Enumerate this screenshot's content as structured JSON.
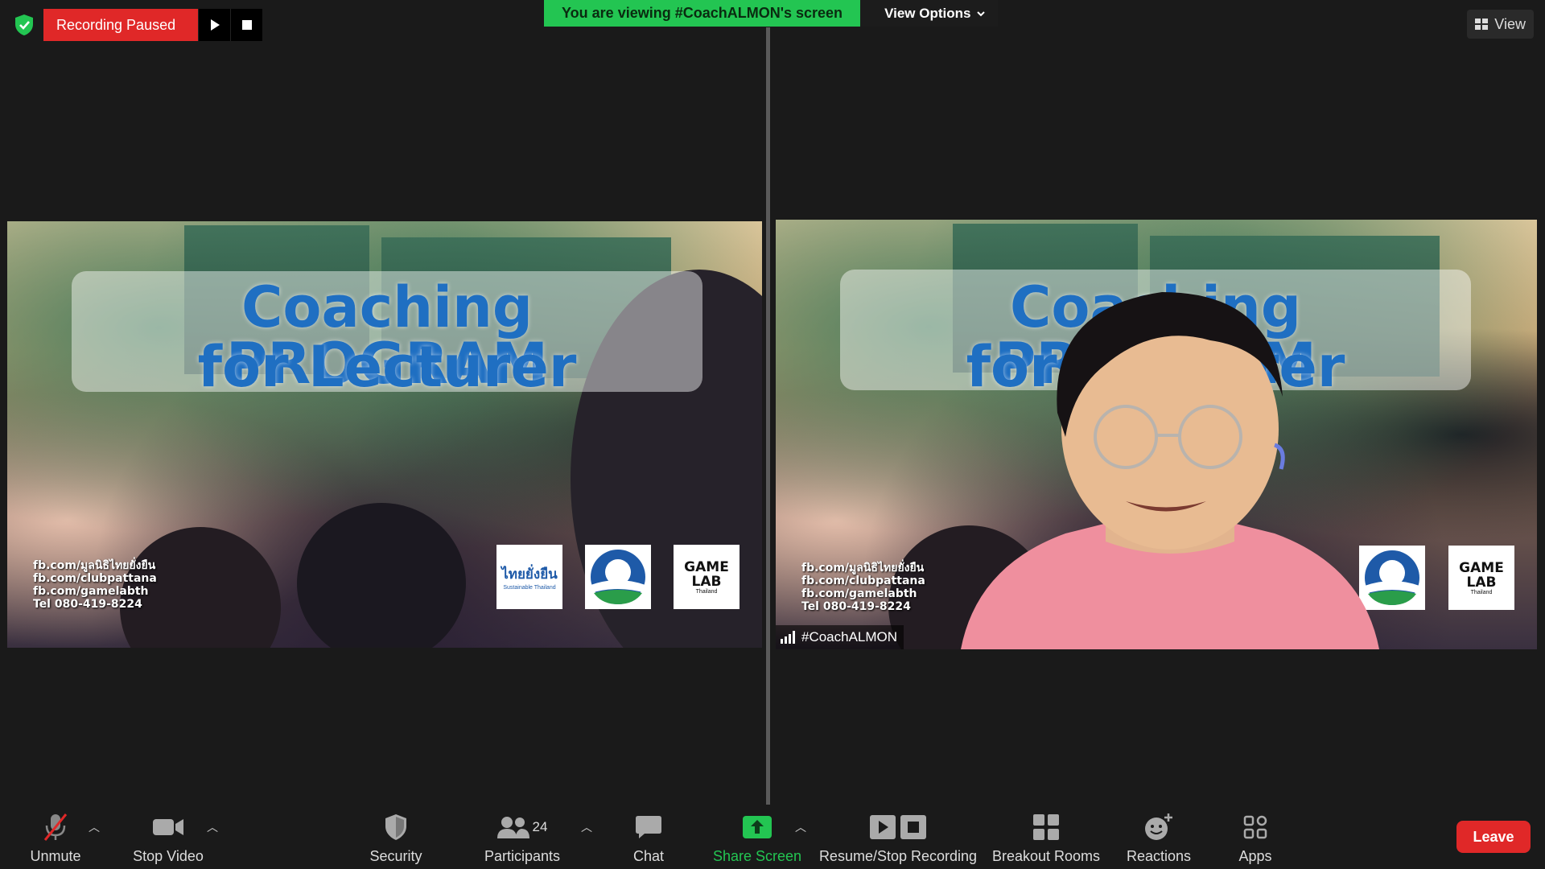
{
  "top_bar": {
    "recording_status": "Recording Paused",
    "viewing_banner": "You are viewing #CoachALMON's screen",
    "view_options_label": "View Options",
    "view_label": "View"
  },
  "shared_screen": {
    "title_line1": "Coaching PROGRAM",
    "title_line2": "for Lecturer",
    "info_lines": [
      "fb.com/มูลนิธิไทยยั่งยืน",
      "fb.com/clubpattana",
      "fb.com/gamelabth",
      "Tel 080-419-8224"
    ],
    "logo1_text": "ไทยยั่งยืน",
    "logo1_sub": "Sustainable Thailand",
    "logo3_line1": "GAME",
    "logo3_line2": "LAB",
    "logo3_sub": "Thailand"
  },
  "speaker": {
    "name": "#CoachALMON"
  },
  "toolbar": {
    "unmute": "Unmute",
    "stop_video": "Stop Video",
    "security": "Security",
    "participants": "Participants",
    "participants_count": "24",
    "chat": "Chat",
    "share_screen": "Share Screen",
    "recording": "Resume/Stop Recording",
    "breakout_rooms": "Breakout Rooms",
    "reactions": "Reactions",
    "apps": "Apps",
    "leave": "Leave"
  },
  "colors": {
    "recording_red": "#e02828",
    "share_green": "#23c552",
    "title_blue": "#1f6fc2",
    "background": "#1a1a1a"
  }
}
